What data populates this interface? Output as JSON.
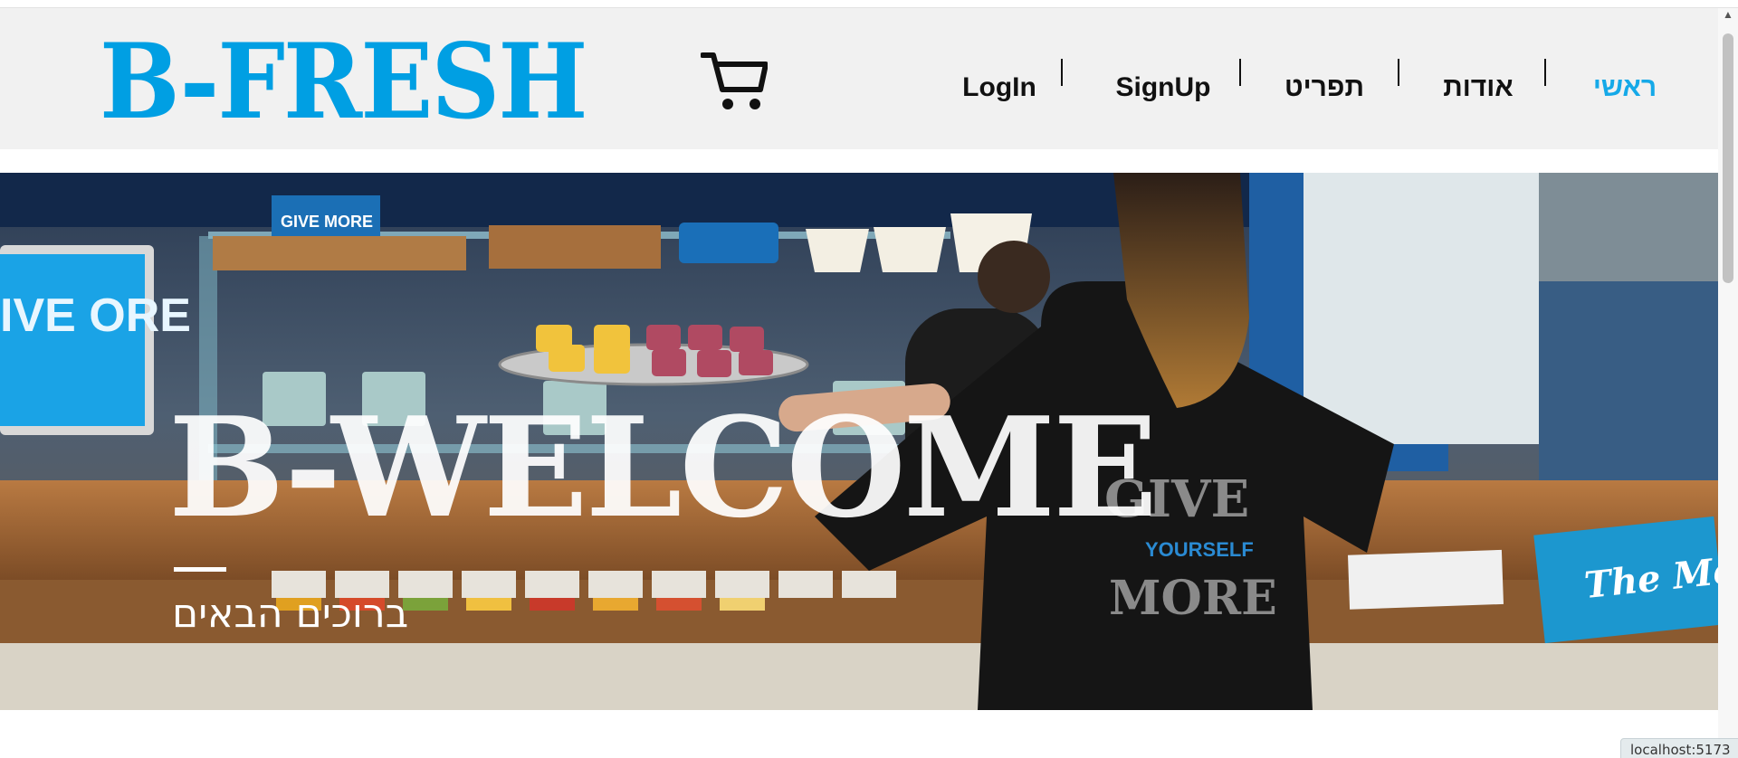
{
  "header": {
    "logo_text": "B-FRESH",
    "cart_icon": "cart-icon",
    "nav": [
      {
        "label": "LogIn",
        "active": false
      },
      {
        "label": "SignUp",
        "active": false
      },
      {
        "label": "תפריט",
        "active": false
      },
      {
        "label": "אודות",
        "active": false
      },
      {
        "label": "ראשי",
        "active": true
      }
    ]
  },
  "hero": {
    "title": "B-WELCOME",
    "subtitle": "ברוכים הבאים",
    "image_texts": {
      "screen_text": "IVE ORE",
      "cup_text": "GIVE MORE",
      "shirt_text_1": "GIVE",
      "shirt_text_2": "YOURSELF",
      "shirt_text_3": "MORE",
      "menu_card": "The Menu"
    }
  },
  "status": {
    "url": "localhost:5173"
  },
  "colors": {
    "brand_blue": "#009fe3",
    "active_nav": "#15a9e8",
    "header_bg": "#f1f1f1",
    "text": "#111111"
  }
}
